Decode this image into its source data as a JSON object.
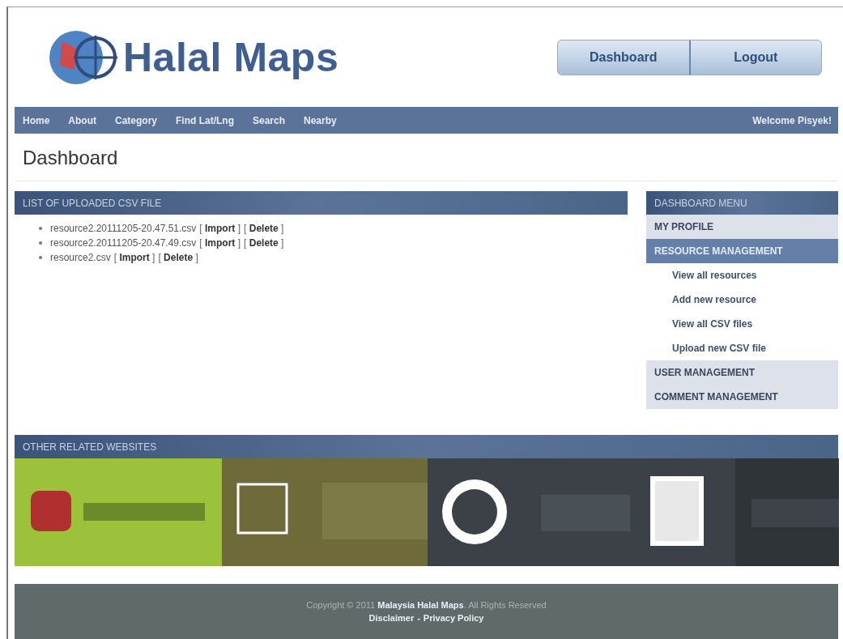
{
  "header": {
    "site_title": "Halal Maps",
    "buttons": [
      "Dashboard",
      "Logout"
    ]
  },
  "nav": {
    "links": [
      "Home",
      "About",
      "Category",
      "Find Lat/Lng",
      "Search",
      "Nearby"
    ],
    "welcome": "Welcome Pisyek!"
  },
  "page_title": "Dashboard",
  "csv_panel": {
    "title": "LIST OF UPLOADED CSV FILE",
    "files": [
      {
        "name": "resource2.20111205-20.47.51.csv",
        "actions": [
          "[ **Import** ]",
          "[ **Delete** ]"
        ]
      },
      {
        "name": "resource2.20111205-20.47.49.csv",
        "actions": [
          "[ **Import** ]",
          "[ **Delete** ]"
        ]
      },
      {
        "name": "resource2.csv",
        "actions": [
          "[ **Import** ]",
          "[ **Delete** ]"
        ]
      }
    ]
  },
  "dashboard_menu": {
    "title": "DASHBOARD MENU",
    "items": [
      {
        "label": "MY PROFILE",
        "selected": false
      },
      {
        "label": "RESOURCE MANAGEMENT",
        "selected": true,
        "children": [
          {
            "label": "View all resources"
          },
          {
            "label": "Add new resource"
          },
          {
            "label": "View all CSV files"
          },
          {
            "label": "Upload new CSV file"
          }
        ]
      },
      {
        "label": "USER MANAGEMENT",
        "selected": false
      },
      {
        "label": "COMMENT MANAGEMENT",
        "selected": false
      }
    ]
  },
  "related": {
    "title": "OTHER RELATED WEBSITES"
  },
  "footer": {
    "copyright": "Copyright © 2011 **Malaysia Halal Maps**. All Rights Reserved",
    "links": [
      "Disclaimer",
      "Privacy Policy"
    ],
    "separator": "-"
  }
}
